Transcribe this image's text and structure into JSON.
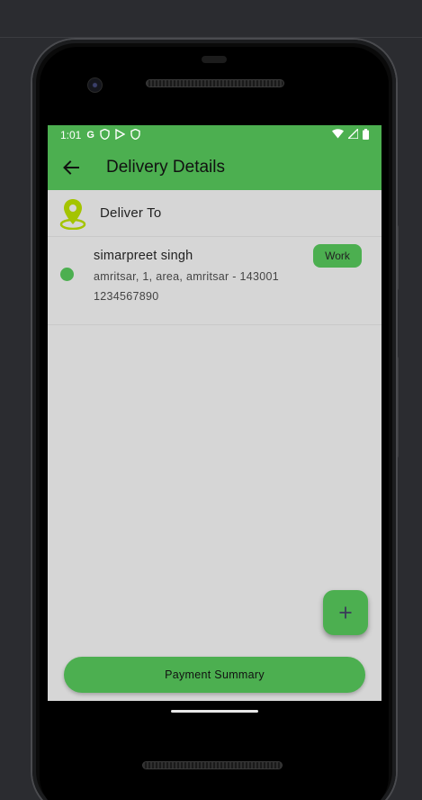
{
  "status_bar": {
    "time": "1:01",
    "left_icons": [
      "google-icon",
      "shield-icon",
      "play-protect-icon",
      "shield-icon"
    ],
    "right_icons": [
      "wifi-icon",
      "signal-icon",
      "battery-icon"
    ]
  },
  "app_bar": {
    "title": "Delivery Details",
    "back_icon": "arrow-left-icon"
  },
  "deliver_to": {
    "label": "Deliver To",
    "icon": "location-pin-icon"
  },
  "addresses": [
    {
      "name": "simarpreet singh",
      "address": "amritsar, 1, area, amritsar - 143001",
      "phone": "1234567890",
      "tag": "Work",
      "selected": true
    }
  ],
  "fab": {
    "icon": "plus-icon",
    "symbol": "+"
  },
  "payment_button": {
    "label": "Payment Summary"
  },
  "colors": {
    "primary": "#4caf50",
    "screen_bg": "#d6d6d6",
    "pin_color": "#a4c400"
  }
}
